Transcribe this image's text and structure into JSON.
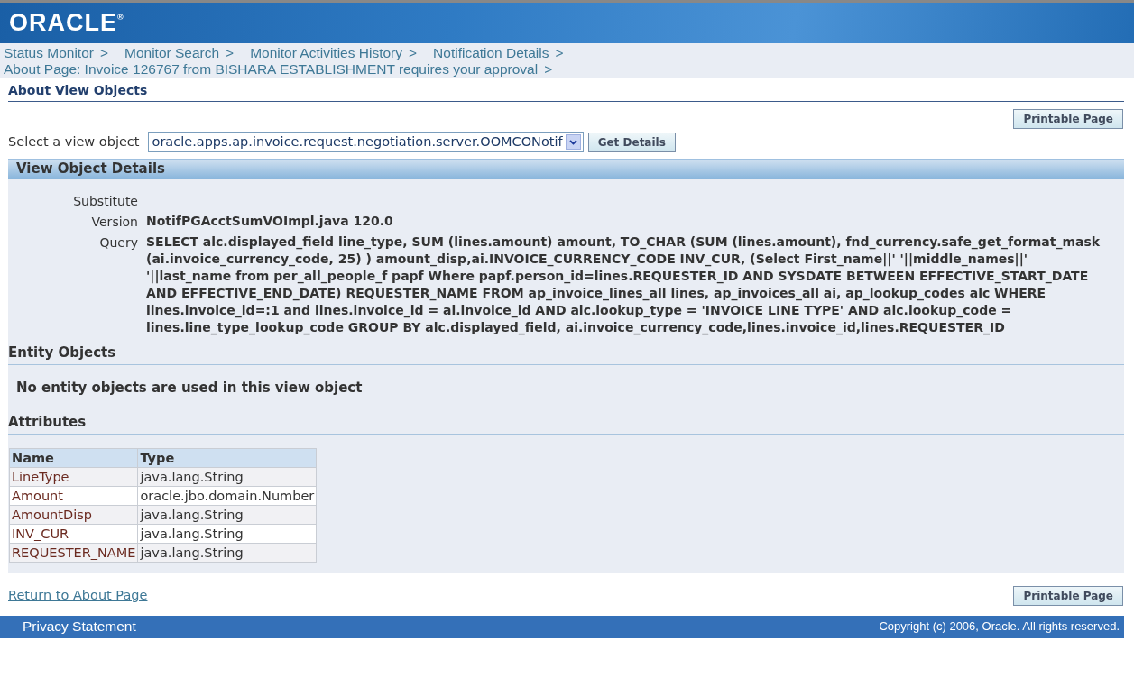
{
  "header": {
    "logo": "ORACLE$^{®}$"
  },
  "breadcrumbs": [
    {
      "label": "Status Monitor",
      "separator": ">"
    },
    {
      "label": "Monitor Search",
      "separator": ">"
    },
    {
      "label": "Monitor Activities History",
      "separator": ">"
    },
    {
      "label": "Notification Details",
      "separator": ">"
    },
    {
      "label": "About Page: Invoice 126767 from BISHARA ESTABLISHMENT requires your approval",
      "separator": ">"
    }
  ],
  "page_title": "About View Objects",
  "top_button": "Printable Page",
  "view_object_select": {
    "label": "Select a view object",
    "value": "oracle.apps.ap.invoice.request.negotiation.server.OOMCONotif",
    "button": "Get Details"
  },
  "details": {
    "title": "View Object Details",
    "fields": [
      {
        "label": "Substitute"
      },
      {
        "label": "Version",
        "value": "NotifPGAcctSumVOImpl.java 120.0"
      },
      {
        "label": "Query",
        "value": "SELECT alc.displayed_field line_type, SUM (lines.amount) amount, TO_CHAR (SUM (lines.amount), fnd_currency.safe_get_format_mask (ai.invoice_currency_code, 25) ) amount_disp,ai.INVOICE_CURRENCY_CODE INV_CUR, (Select First_name||' '||middle_names||' '||last_name from per_all_people_f papf Where papf.person_id=lines.REQUESTER_ID AND SYSDATE BETWEEN EFFECTIVE_START_DATE AND EFFECTIVE_END_DATE) REQUESTER_NAME FROM ap_invoice_lines_all lines, ap_invoices_all ai, ap_lookup_codes alc WHERE lines.invoice_id=:1 and lines.invoice_id = ai.invoice_id AND alc.lookup_type = 'INVOICE LINE TYPE' AND alc.lookup_code = lines.line_type_lookup_code GROUP BY alc.displayed_field, ai.invoice_currency_code,lines.invoice_id,lines.REQUESTER_ID"
      }
    ],
    "entity_objects": {
      "title": "Entity Objects",
      "message": "No entity objects are used in this view object"
    },
    "attributes": {
      "title": "Attributes",
      "columns": [
        "Name",
        "Type"
      ],
      "rows": [
        [
          "LineType",
          "java.lang.String"
        ],
        [
          "Amount",
          "oracle.jbo.domain.Number"
        ],
        [
          "AmountDisp",
          "java.lang.String"
        ],
        [
          "INV_CUR",
          "java.lang.String"
        ],
        [
          "REQUESTER_NAME",
          "java.lang.String"
        ]
      ]
    }
  },
  "return_link": "Return to About Page",
  "bottom_button": "Printable Page",
  "footer": {
    "link": "Privacy Statement",
    "copyright": "Copyright (c) 2006, Oracle. All rights reserved."
  }
}
